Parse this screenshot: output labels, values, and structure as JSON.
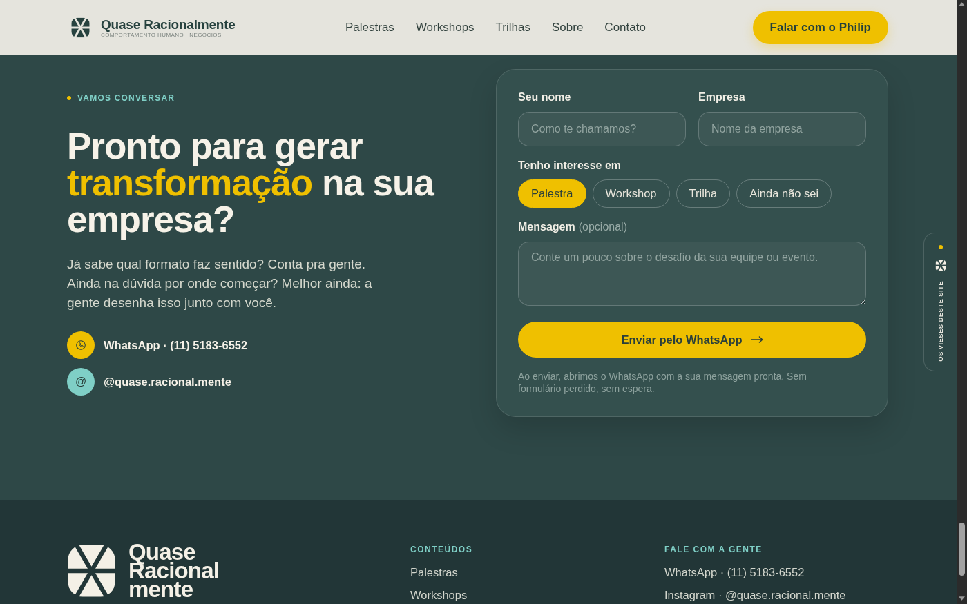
{
  "header": {
    "logo": {
      "name": "Quase Racionalmente",
      "tagline": "COMPORTAMENTO HUMANO · NEGÓCIOS"
    },
    "nav": [
      "Palestras",
      "Workshops",
      "Trilhas",
      "Sobre",
      "Contato"
    ],
    "cta": "Falar com o Philip"
  },
  "contact": {
    "eyebrow": "VAMOS CONVERSAR",
    "heading": {
      "before": "Pronto para gerar",
      "highlight": "transformação",
      "after": "na sua empresa?"
    },
    "intro": "Já sabe qual formato faz sentido? Conta pra gente. Ainda na dúvida por onde começar? Melhor ainda: a gente desenha isso junto com você.",
    "channels": [
      {
        "kind": "phone",
        "color": "#efc000",
        "label": "WhatsApp · (11) 5183-6552"
      },
      {
        "kind": "at",
        "color": "#7fcfc6",
        "symbol": "@",
        "label": "@quase.racional.mente"
      }
    ]
  },
  "form": {
    "fields": [
      {
        "label": "Seu nome",
        "placeholder": "Como te chamamos?"
      },
      {
        "label": "Empresa",
        "placeholder": "Nome da empresa"
      }
    ],
    "interest": {
      "label": "Tenho interesse em",
      "options": [
        {
          "label": "Palestra",
          "selected": true
        },
        {
          "label": "Workshop",
          "selected": false
        },
        {
          "label": "Trilha",
          "selected": false
        },
        {
          "label": "Ainda não sei",
          "selected": false
        }
      ]
    },
    "message": {
      "label": "Mensagem",
      "note": "(opcional)",
      "placeholder": "Conte um pouco sobre o desafio da sua equipe ou evento."
    },
    "submit": "Enviar pelo WhatsApp",
    "disclaimer": "Ao enviar, abrimos o WhatsApp com a sua mensagem pronta. Sem formulário perdido, sem espera."
  },
  "side_tab": {
    "label": "OS VIESES DESTE SITE"
  },
  "footer": {
    "wordmark": [
      "Quase",
      "Racional",
      "mente"
    ],
    "columns": [
      {
        "title": "CONTEÚDOS",
        "links": [
          "Palestras",
          "Workshops"
        ]
      },
      {
        "title": "FALE COM A GENTE",
        "links": [
          "WhatsApp · (11) 5183-6552",
          "Instagram · @quase.racional.mente"
        ]
      }
    ]
  }
}
